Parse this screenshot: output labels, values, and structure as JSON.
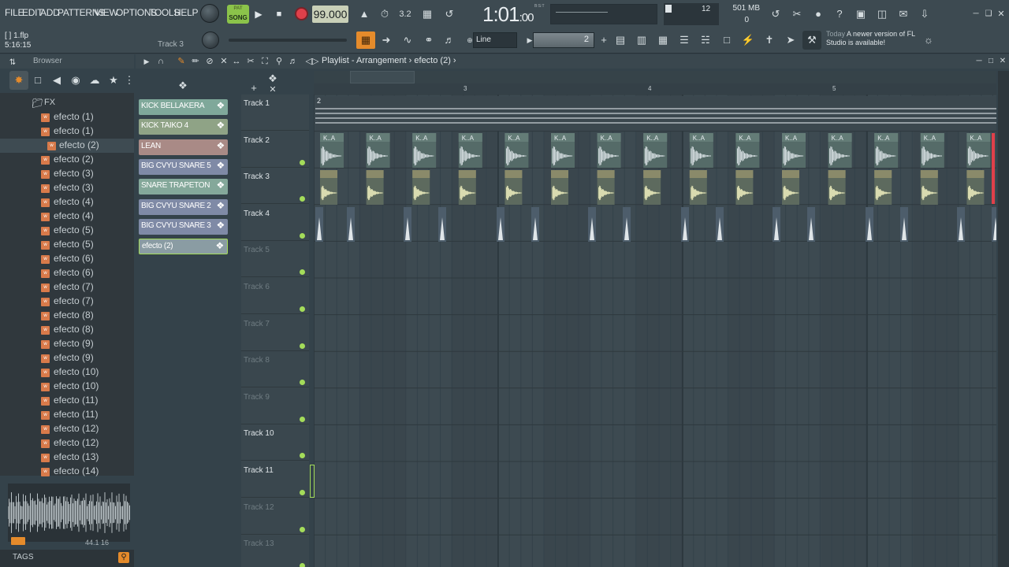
{
  "menu": {
    "file": "FILE",
    "edit": "EDIT",
    "add": "ADD",
    "patterns": "PATTERNS",
    "view": "VIEW",
    "options": "OPTIONS",
    "tools": "TOOLS",
    "help": "HELP"
  },
  "transport": {
    "mode_label": "SONG",
    "pattern_mode_label": "PAT",
    "tempo": "99.000",
    "time_main": "1:01",
    "time_frac": ":00",
    "time_unit_label": "B:S:T"
  },
  "cpu": {
    "value": "12"
  },
  "memory": {
    "usage": "501 MB",
    "polyphony": "0"
  },
  "hint": {
    "filename": "[    ] 1.flp",
    "time": "5:16:15",
    "track": "Track 3"
  },
  "snap": {
    "value": "Line"
  },
  "pattern_selector": {
    "value": "2"
  },
  "news": {
    "label": "Today",
    "text": "A newer version of FL Studio is available!"
  },
  "browser": {
    "title": "Browser",
    "folder": "FX",
    "items": [
      "efecto (1)",
      "efecto (1)",
      "efecto (2)",
      "efecto (2)",
      "efecto (3)",
      "efecto (3)",
      "efecto (4)",
      "efecto (4)",
      "efecto (5)",
      "efecto (5)",
      "efecto (6)",
      "efecto (6)",
      "efecto (7)",
      "efecto (7)",
      "efecto (8)",
      "efecto (8)",
      "efecto (9)",
      "efecto (9)",
      "efecto (10)",
      "efecto (10)",
      "efecto (11)",
      "efecto (11)",
      "efecto (12)",
      "efecto (12)",
      "efecto (13)",
      "efecto (14)"
    ],
    "selected_index": 2,
    "sample_info": "44.1 16",
    "tags_label": "TAGS"
  },
  "playlist": {
    "title": "Playlist - Arrangement",
    "breadcrumb": "efecto (2)",
    "clips": [
      {
        "name": "KICK BELLAKERA",
        "color": "#7fa89a"
      },
      {
        "name": "KICK TAIKO 4",
        "color": "#8fa386"
      },
      {
        "name": "LEAN",
        "color": "#a98a86"
      },
      {
        "name": "BIG CVYU SNARE 5",
        "color": "#7f8aa6"
      },
      {
        "name": "SNARE TRAPETON",
        "color": "#84a89a"
      },
      {
        "name": "BIG CVYU SNARE 2",
        "color": "#7f8aa6"
      },
      {
        "name": "BIG CVYU SNARE 3",
        "color": "#7f8aa6"
      },
      {
        "name": "efecto (2)",
        "color": "#8a9ca3"
      }
    ],
    "tracks": [
      "Track 1",
      "Track 2",
      "Track 3",
      "Track 4",
      "Track 5",
      "Track 6",
      "Track 7",
      "Track 8",
      "Track 9",
      "Track 10",
      "Track 11",
      "Track 12",
      "Track 13"
    ],
    "ruler_marks": [
      "3",
      "4",
      "5"
    ],
    "pattern_label": "2",
    "clip_label": "K..A"
  }
}
